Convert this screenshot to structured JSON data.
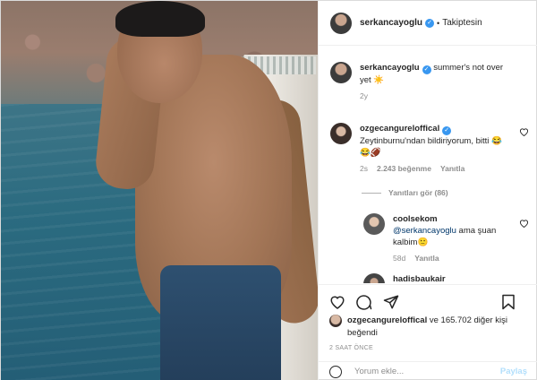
{
  "post": {
    "author": "serkancayoglu",
    "follow_state": "Takiptesin",
    "caption": "summer's not over yet ☀️",
    "caption_age": "2y"
  },
  "comments": [
    {
      "user": "ozgecangureloffical",
      "text": "Zeytinburnu'ndan bildiriyorum, bitti 😂😂🏈",
      "age": "2s",
      "likes": "2.243 beğenme",
      "reply_label": "Yanıtla"
    },
    {
      "user": "coolsekom",
      "mention": "@serkancayoglu",
      "text": " ama şuan kalbim🙂",
      "age": "58d",
      "reply_label": "Yanıtla"
    },
    {
      "user": "hadisbaukair"
    }
  ],
  "replies_toggle": "Yanıtları gör (86)",
  "likes_line": {
    "user": "ozgecangureloffical",
    "rest": " ve 165.702 diğer kişi beğendi"
  },
  "timestamp": "2 SAAT ÖNCE",
  "add_comment": {
    "placeholder": "Yorum ekle...",
    "post_label": "Paylaş"
  },
  "icons": {
    "verified": "verified-icon",
    "like": "heart-icon",
    "comment": "comment-icon",
    "share": "share-icon",
    "save": "bookmark-icon",
    "emoji": "emoji-icon"
  },
  "colors": {
    "verified": "#3897f0",
    "muted": "#8e8e8e",
    "link": "#00376b",
    "post_disabled": "#b2dffc"
  }
}
